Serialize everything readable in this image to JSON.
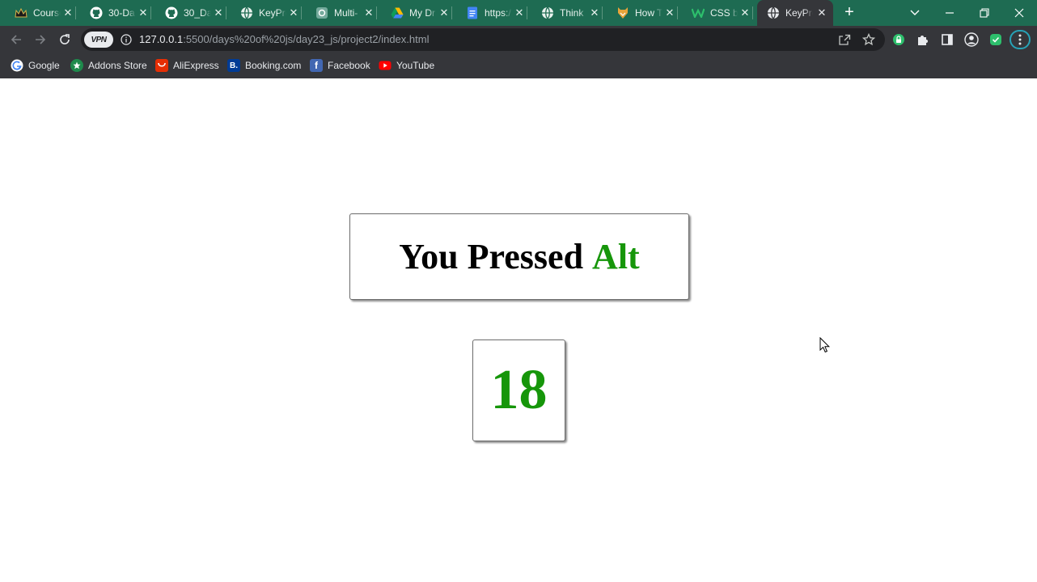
{
  "browser": {
    "tabs": [
      {
        "label": "Course",
        "icon": "crown-icon"
      },
      {
        "label": "30-Da",
        "icon": "github-icon"
      },
      {
        "label": "30_Da",
        "icon": "github-icon"
      },
      {
        "label": "KeyPre",
        "icon": "globe-icon"
      },
      {
        "label": "Multi-",
        "icon": "openai-icon"
      },
      {
        "label": "My Dr",
        "icon": "google-drive-icon"
      },
      {
        "label": "https:/",
        "icon": "docs-icon"
      },
      {
        "label": "Think",
        "icon": "globe-icon"
      },
      {
        "label": "How T",
        "icon": "fox-icon"
      },
      {
        "label": "CSS b",
        "icon": "w-icon"
      },
      {
        "label": "KeyPre",
        "icon": "globe-icon",
        "active": true
      }
    ],
    "new_tab_label": "+",
    "vpn_label": "VPN",
    "url_host": "127.0.0.1",
    "url_rest": ":5500/days%20of%20js/day23_js/project2/index.html",
    "bookmarks": [
      {
        "label": "Google",
        "icon": "google-icon"
      },
      {
        "label": "Addons Store",
        "icon": "addons-store-icon"
      },
      {
        "label": "AliExpress",
        "icon": "aliexpress-icon"
      },
      {
        "label": "Booking.com",
        "icon": "booking-icon",
        "glyph": "B."
      },
      {
        "label": "Facebook",
        "icon": "facebook-icon",
        "glyph": "f"
      },
      {
        "label": "YouTube",
        "icon": "youtube-icon"
      }
    ]
  },
  "app": {
    "prefix_text": "You Pressed",
    "key_name": "Alt",
    "key_code": "18"
  },
  "colors": {
    "tab_strip": "#1e6b52",
    "toolbar": "#35363a",
    "key_highlight": "#16960a"
  }
}
